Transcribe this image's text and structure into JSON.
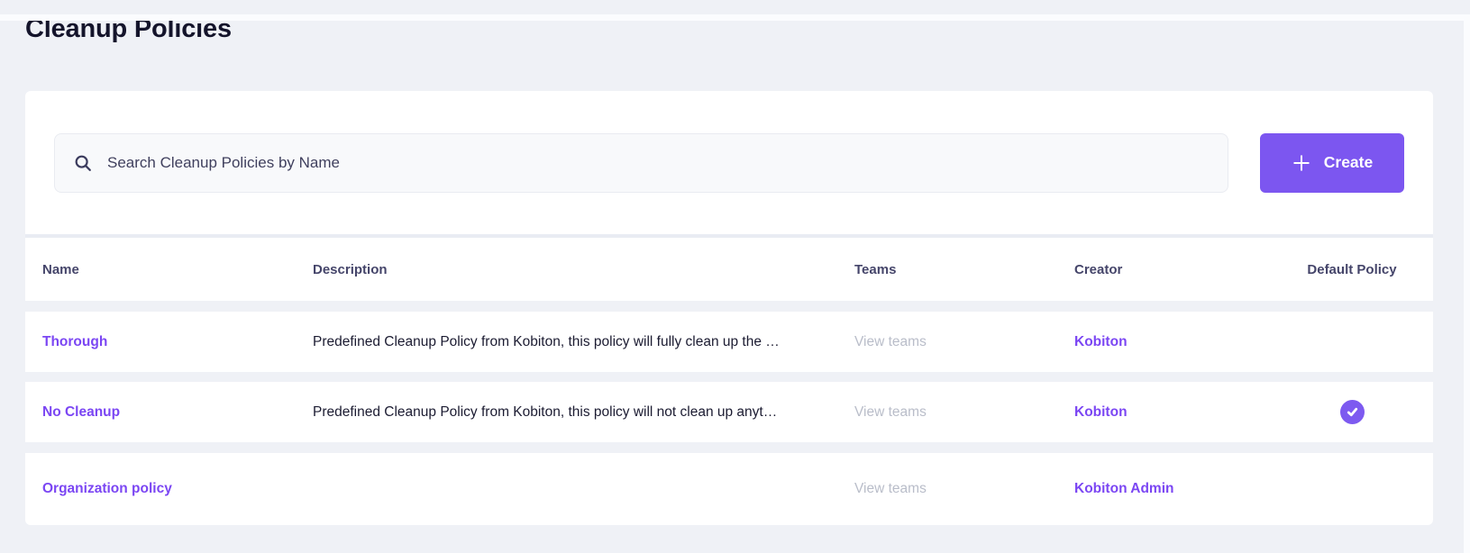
{
  "page": {
    "title": "Cleanup Policies"
  },
  "colors": {
    "accent_purple": "#7c56f0",
    "link_purple": "#7b46f3",
    "badge_purple": "#7d5af0",
    "muted_gray": "#b9bdc9",
    "page_background": "#eff1f6",
    "heading_text": "#14142b",
    "header_text": "#45456a"
  },
  "search": {
    "placeholder": "Search Cleanup Policies by Name",
    "value": "",
    "icon": "search-icon"
  },
  "create_button": {
    "label": "Create",
    "icon": "plus-icon"
  },
  "table": {
    "columns": [
      "Name",
      "Description",
      "Teams",
      "Creator",
      "Default Policy"
    ],
    "rows": [
      {
        "name": "Thorough",
        "description": "Predefined Cleanup Policy from Kobiton, this policy will fully clean up the …",
        "teams_link": "View teams",
        "creator": "Kobiton",
        "is_default": false
      },
      {
        "name": "No Cleanup",
        "description": "Predefined Cleanup Policy from Kobiton, this policy will not clean up anyt…",
        "teams_link": "View teams",
        "creator": "Kobiton",
        "is_default": true
      },
      {
        "name": "Organization policy",
        "description": "",
        "teams_link": "View teams",
        "creator": "Kobiton Admin",
        "is_default": false
      }
    ],
    "default_badge_icon": "check-icon"
  }
}
